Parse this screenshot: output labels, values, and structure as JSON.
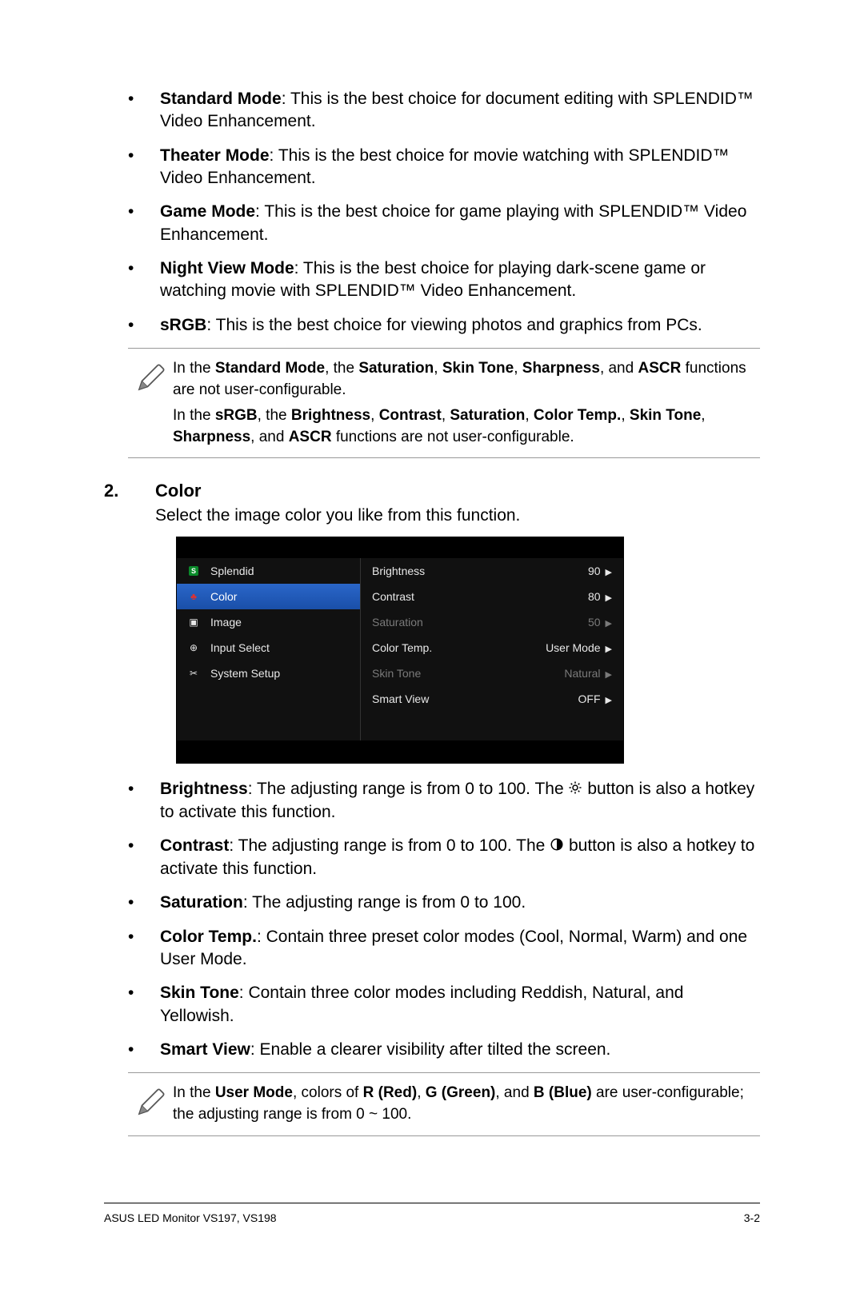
{
  "bullets_top": [
    {
      "label": "Standard Mode",
      "text": ": This is the best choice for document editing with SPLENDID™ Video Enhancement."
    },
    {
      "label": "Theater Mode",
      "text": ": This is the best choice for movie watching with SPLENDID™ Video Enhancement."
    },
    {
      "label": "Game Mode",
      "text": ": This is the best choice for game playing with SPLENDID™ Video Enhancement."
    },
    {
      "label": "Night View Mode",
      "text": ": This is the best choice for playing dark-scene game or watching movie with SPLENDID™ Video Enhancement."
    },
    {
      "label": "sRGB",
      "text": ": This is the best choice for viewing photos and graphics from PCs."
    }
  ],
  "note1": {
    "p1_a": "In the ",
    "p1_b": "Standard Mode",
    "p1_c": ", the ",
    "p1_d": "Saturation",
    "p1_e": ", ",
    "p1_f": "Skin Tone",
    "p1_g": ", ",
    "p1_h": "Sharpness",
    "p1_i": ", and ",
    "p1_j": "ASCR",
    "p1_k": " functions are not user-configurable.",
    "p2_a": "In the ",
    "p2_b": "sRGB",
    "p2_c": ", the ",
    "p2_d": "Brightness",
    "p2_e": ", ",
    "p2_f": "Contrast",
    "p2_g": ", ",
    "p2_h": "Saturation",
    "p2_i": ", ",
    "p2_j": "Color Temp.",
    "p2_k": ", ",
    "p2_l": "Skin Tone",
    "p2_m": ", ",
    "p2_n": "Sharpness",
    "p2_o": ", and ",
    "p2_p": "ASCR",
    "p2_q": " functions are not user-configurable."
  },
  "section": {
    "num": "2.",
    "title": "Color",
    "desc": "Select the image color you like from this function."
  },
  "osd": {
    "left": [
      {
        "label": "Splendid",
        "icon": "s"
      },
      {
        "label": "Color",
        "icon": "color",
        "selected": true
      },
      {
        "label": "Image",
        "icon": "image"
      },
      {
        "label": "Input Select",
        "icon": "input"
      },
      {
        "label": "System Setup",
        "icon": "setup"
      }
    ],
    "right": [
      {
        "label": "Brightness",
        "value": "90",
        "disabled": false
      },
      {
        "label": "Contrast",
        "value": "80",
        "disabled": false
      },
      {
        "label": "Saturation",
        "value": "50",
        "disabled": true
      },
      {
        "label": "Color Temp.",
        "value": "User Mode",
        "disabled": false
      },
      {
        "label": "Skin Tone",
        "value": "Natural",
        "disabled": true
      },
      {
        "label": "Smart View",
        "value": "OFF",
        "disabled": false
      }
    ]
  },
  "bullets_bottom": [
    {
      "label": "Brightness",
      "pre": ": The adjusting range is from 0 to 100. The ",
      "post": " button is also a hotkey to activate this function.",
      "icon": "sun"
    },
    {
      "label": "Contrast",
      "pre": ": The adjusting range is from 0 to 100. The ",
      "post": " button is also a hotkey to activate this function.",
      "icon": "contrast"
    },
    {
      "label": "Saturation",
      "pre": ": The adjusting range is from 0 to 100.",
      "post": "",
      "icon": ""
    },
    {
      "label": "Color Temp.",
      "pre": ": Contain three preset color modes (Cool, Normal, Warm) and one User Mode.",
      "post": "",
      "icon": ""
    },
    {
      "label": "Skin Tone",
      "pre": ": Contain three color modes including Reddish, Natural, and Yellowish.",
      "post": "",
      "icon": ""
    },
    {
      "label": "Smart View",
      "pre": ": Enable a clearer visibility after tilted the screen.",
      "post": "",
      "icon": ""
    }
  ],
  "note2": {
    "a": "In the ",
    "b": "User Mode",
    "c": ", colors of ",
    "d": "R (Red)",
    "e": ", ",
    "f": "G (Green)",
    "g": ", and ",
    "h": "B (Blue)",
    "i": " are user-configurable; the adjusting range is from 0 ~ 100."
  },
  "footer": {
    "left": "ASUS LED Monitor VS197, VS198",
    "right": "3-2"
  },
  "marker": "•"
}
